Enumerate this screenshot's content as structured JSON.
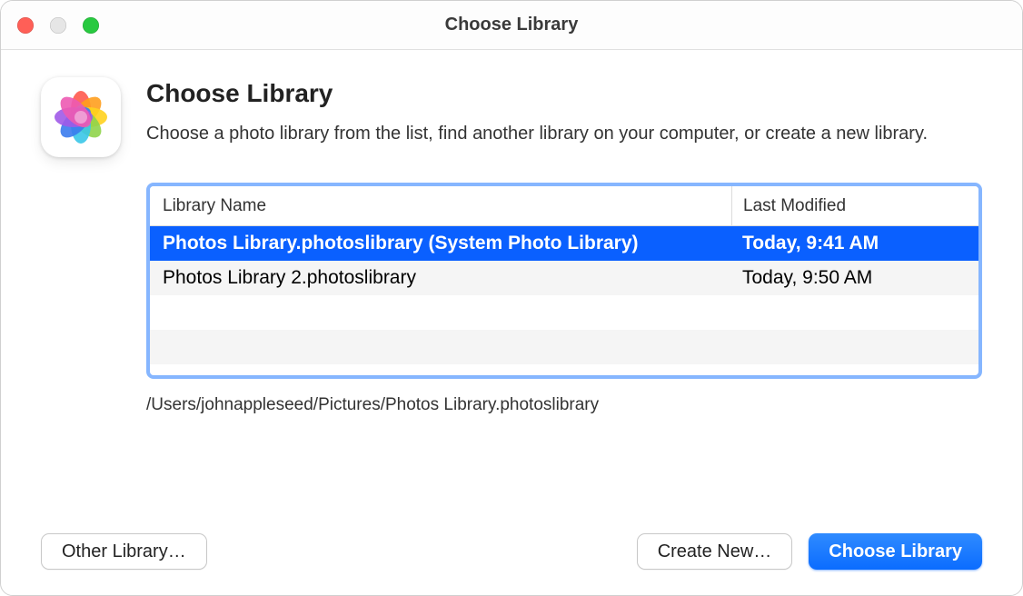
{
  "window": {
    "title": "Choose Library"
  },
  "dialog": {
    "heading": "Choose Library",
    "subtext": "Choose a photo library from the list, find another library on your computer, or create a new library."
  },
  "list": {
    "columns": {
      "name": "Library Name",
      "modified": "Last Modified"
    },
    "rows": [
      {
        "name": "Photos Library.photoslibrary (System Photo Library)",
        "modified": "Today, 9:41 AM",
        "selected": true
      },
      {
        "name": "Photos Library 2.photoslibrary",
        "modified": "Today, 9:50 AM",
        "selected": false
      }
    ]
  },
  "path": "/Users/johnappleseed/Pictures/Photos Library.photoslibrary",
  "buttons": {
    "other": "Other Library…",
    "create": "Create New…",
    "choose": "Choose Library"
  }
}
